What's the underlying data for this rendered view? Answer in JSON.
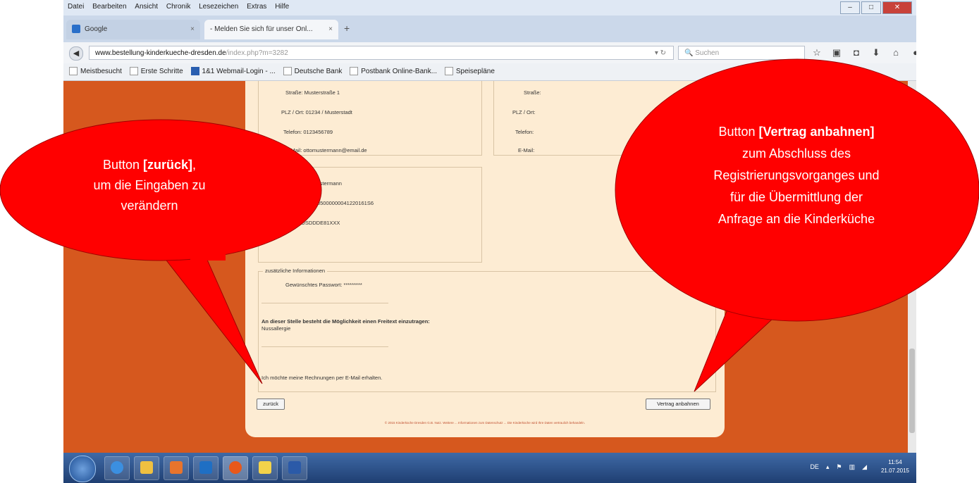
{
  "menubar": [
    "Datei",
    "Bearbeiten",
    "Ansicht",
    "Chronik",
    "Lesezeichen",
    "Extras",
    "Hilfe"
  ],
  "tabs": [
    {
      "label": "Google"
    },
    {
      "label": "- Melden Sie sich für unser Onl..."
    }
  ],
  "nav": {
    "url_host": "www.bestellung-kinderkueche-dresden.de",
    "url_path": "/index.php?m=3282",
    "search_placeholder": "Suchen"
  },
  "bookmarks": [
    "Meistbesucht",
    "Erste Schritte",
    "1&1 Webmail-Login - ...",
    "Deutsche Bank",
    "Postbank Online-Bank...",
    "Speisepläne"
  ],
  "left_address": {
    "strasse": "Straße: Musterstraße 1",
    "plz": "PLZ / Ort: 01234 / Musterstadt",
    "telefon": "Telefon: 0123456789",
    "email": "E-Mail: ottomustermann@email.de"
  },
  "right_address": {
    "strasse": "Straße:",
    "plz": "PLZ / Ort:",
    "telefon": "Telefon:",
    "email": "E-Mail:"
  },
  "bank": {
    "legend": "...indung",
    "name": "Otto Mustermann",
    "iban": "DE91785000000041220161S6",
    "bic": "OSDDDE81XXX"
  },
  "zusatz": {
    "legend": "zusätzliche Informationen",
    "passwort": "Gewünschtes Passwort: *********",
    "freitext_label": "An dieser Stelle besteht die Möglichkeit einen Freitext einzutragen:",
    "freitext_value": "Nussallergie",
    "rechnung": "Ich möchte meine Rechnungen per E-Mail erhalten."
  },
  "buttons": {
    "zurueck": "zurück",
    "vertrag": "Vertrag anbahnen"
  },
  "footer": "© 2015 Kinderküche Dresden G.B. Nutz. Weitere ... Informationen zum Datenschutz ... Die Kinderküche wird Ihre Daten vertraulich behandeln.",
  "taskbar": {
    "time": "11:54",
    "date": "21.07.2015",
    "lang": "DE"
  },
  "callouts": {
    "left": {
      "pre": "Button ",
      "bold": "[zurück]",
      "post": ",",
      "line2": "um die Eingaben zu",
      "line3": "verändern"
    },
    "right": {
      "pre": "Button ",
      "bold": "[Vertrag anbahnen]",
      "line2": "zum Abschluss des",
      "line3": "Registrierungsvorganges und",
      "line4": "für die Übermittlung der",
      "line5": "Anfrage an die Kinderküche"
    }
  },
  "colors": {
    "page_background": "#d6581e",
    "panel": "#fdecd3",
    "callout": "#ff0000"
  }
}
